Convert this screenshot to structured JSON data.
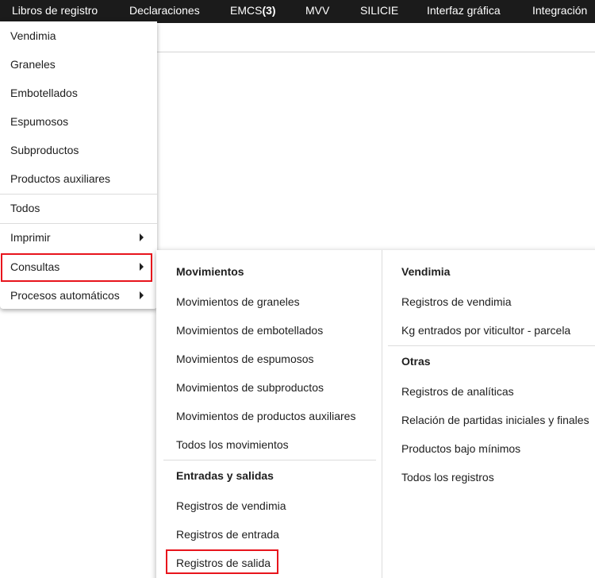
{
  "topnav": {
    "items": [
      {
        "label": "Libros de registro"
      },
      {
        "label": "Declaraciones"
      },
      {
        "label": "EMCS",
        "count": "(3)"
      },
      {
        "label": "MVV"
      },
      {
        "label": "SILICIE"
      },
      {
        "label": "Interfaz gráfica"
      },
      {
        "label": "Integración"
      }
    ]
  },
  "dropdown": {
    "items": [
      {
        "label": "Vendimia"
      },
      {
        "label": "Graneles"
      },
      {
        "label": "Embotellados"
      },
      {
        "label": "Espumosos"
      },
      {
        "label": "Subproductos"
      },
      {
        "label": "Productos auxiliares"
      },
      {
        "label": "Todos"
      },
      {
        "label": "Imprimir"
      },
      {
        "label": "Consultas"
      },
      {
        "label": "Procesos automáticos"
      }
    ]
  },
  "submenu": {
    "movimientos": {
      "heading": "Movimientos",
      "links": [
        "Movimientos de graneles",
        "Movimientos de embotellados",
        "Movimientos de espumosos",
        "Movimientos de subproductos",
        "Movimientos de productos auxiliares",
        "Todos los movimientos"
      ]
    },
    "entradas_salidas": {
      "heading": "Entradas y salidas",
      "links": [
        "Registros de vendimia",
        "Registros de entrada",
        "Registros de salida"
      ]
    },
    "vendimia": {
      "heading": "Vendimia",
      "links": [
        "Registros de vendimia",
        "Kg entrados por viticultor - parcela"
      ]
    },
    "otras": {
      "heading": "Otras",
      "links": [
        "Registros de analíticas",
        "Relación de partidas iniciales y finales",
        "Productos bajo mínimos",
        "Todos los registros"
      ]
    }
  },
  "colors": {
    "topbar_bg": "#1b1b1b",
    "highlight": "#e8141c",
    "text": "#202020"
  }
}
